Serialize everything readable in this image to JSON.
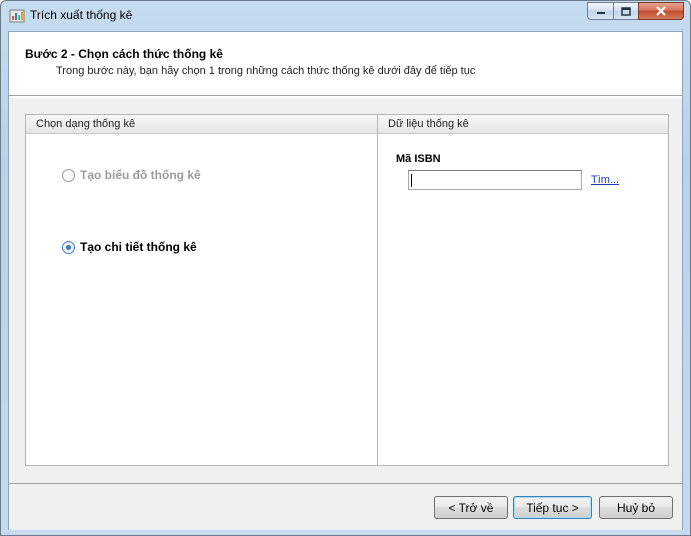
{
  "window": {
    "title": "Trích xuất thống kê"
  },
  "header": {
    "title": "Bước 2 - Chọn cách thức thống kê",
    "subtitle": "Trong bước này, bạn hãy chọn 1 trong những cách thức thống kê dưới đây để tiếp tục"
  },
  "left_panel": {
    "title": "Chọn dạng thống kê",
    "options": [
      {
        "label": "Tạo biểu đồ thống kê",
        "checked": false,
        "enabled": false
      },
      {
        "label": "Tạo chi tiết thống kê",
        "checked": true,
        "enabled": true
      }
    ]
  },
  "right_panel": {
    "title": "Dữ liệu thống kê",
    "isbn_label": "Mã ISBN",
    "isbn_value": "",
    "find_link": "Tìm..."
  },
  "buttons": {
    "back": "< Trở về",
    "next": "Tiếp tục >",
    "cancel": "Huỷ bỏ"
  }
}
